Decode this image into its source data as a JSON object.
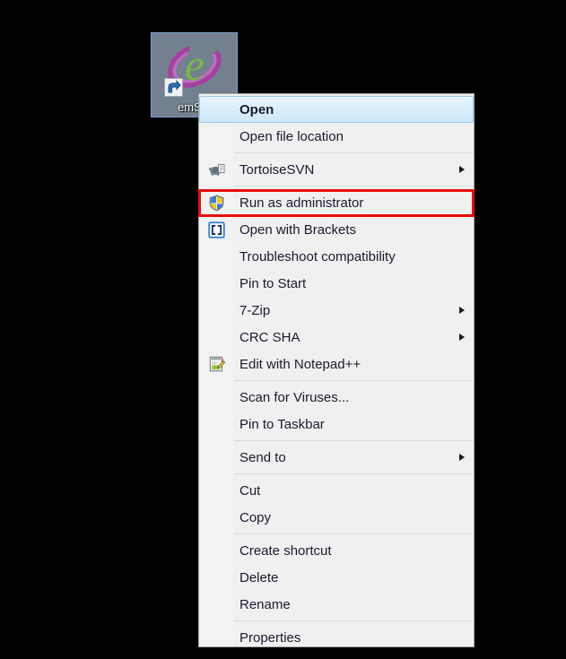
{
  "desktop": {
    "icon": {
      "name": "emSigner application shortcut",
      "label": "emSig",
      "glyph_letter": "e",
      "glyph_color": "#7ab648",
      "swoosh_color": "#a83fa0",
      "selected": true,
      "has_shortcut_overlay": true,
      "overlay_icon": "shortcut-arrow-icon"
    },
    "background_color": "#000000"
  },
  "context_menu": {
    "name": "file-context-menu",
    "background_color": "#f0f0f0",
    "border_color": "#a8a8a8",
    "highlight_color": "#cfe9fb",
    "groups": [
      {
        "items": [
          {
            "label": "Open",
            "icon": null,
            "submenu": false,
            "highlighted": true,
            "bold": true
          },
          {
            "label": "Open file location",
            "icon": null,
            "submenu": false,
            "highlighted": false,
            "bold": false
          }
        ]
      },
      {
        "items": [
          {
            "label": "TortoiseSVN",
            "icon": "tortoise-svn-icon",
            "submenu": true,
            "highlighted": false,
            "bold": false
          }
        ]
      },
      {
        "items": [
          {
            "label": "Run as administrator",
            "icon": "uac-shield-icon",
            "submenu": false,
            "highlighted": false,
            "bold": false,
            "annotated": true
          },
          {
            "label": "Open with Brackets",
            "icon": "brackets-icon",
            "submenu": false,
            "highlighted": false,
            "bold": false
          },
          {
            "label": "Troubleshoot compatibility",
            "icon": null,
            "submenu": false,
            "highlighted": false,
            "bold": false
          },
          {
            "label": "Pin to Start",
            "icon": null,
            "submenu": false,
            "highlighted": false,
            "bold": false
          },
          {
            "label": "7-Zip",
            "icon": null,
            "submenu": true,
            "highlighted": false,
            "bold": false
          },
          {
            "label": "CRC SHA",
            "icon": null,
            "submenu": true,
            "highlighted": false,
            "bold": false
          },
          {
            "label": "Edit with Notepad++",
            "icon": "notepad-plus-plus-icon",
            "submenu": false,
            "highlighted": false,
            "bold": false
          }
        ]
      },
      {
        "items": [
          {
            "label": "Scan for Viruses...",
            "icon": null,
            "submenu": false,
            "highlighted": false,
            "bold": false
          },
          {
            "label": "Pin to Taskbar",
            "icon": null,
            "submenu": false,
            "highlighted": false,
            "bold": false
          }
        ]
      },
      {
        "items": [
          {
            "label": "Send to",
            "icon": null,
            "submenu": true,
            "highlighted": false,
            "bold": false
          }
        ]
      },
      {
        "items": [
          {
            "label": "Cut",
            "icon": null,
            "submenu": false,
            "highlighted": false,
            "bold": false
          },
          {
            "label": "Copy",
            "icon": null,
            "submenu": false,
            "highlighted": false,
            "bold": false
          }
        ]
      },
      {
        "items": [
          {
            "label": "Create shortcut",
            "icon": null,
            "submenu": false,
            "highlighted": false,
            "bold": false
          },
          {
            "label": "Delete",
            "icon": null,
            "submenu": false,
            "highlighted": false,
            "bold": false
          },
          {
            "label": "Rename",
            "icon": null,
            "submenu": false,
            "highlighted": false,
            "bold": false
          }
        ]
      },
      {
        "items": [
          {
            "label": "Properties",
            "icon": null,
            "submenu": false,
            "highlighted": false,
            "bold": false
          }
        ]
      }
    ]
  },
  "annotation": {
    "name": "run-as-administrator-highlight",
    "color": "#e80e0e",
    "target_label": "Run as administrator"
  }
}
